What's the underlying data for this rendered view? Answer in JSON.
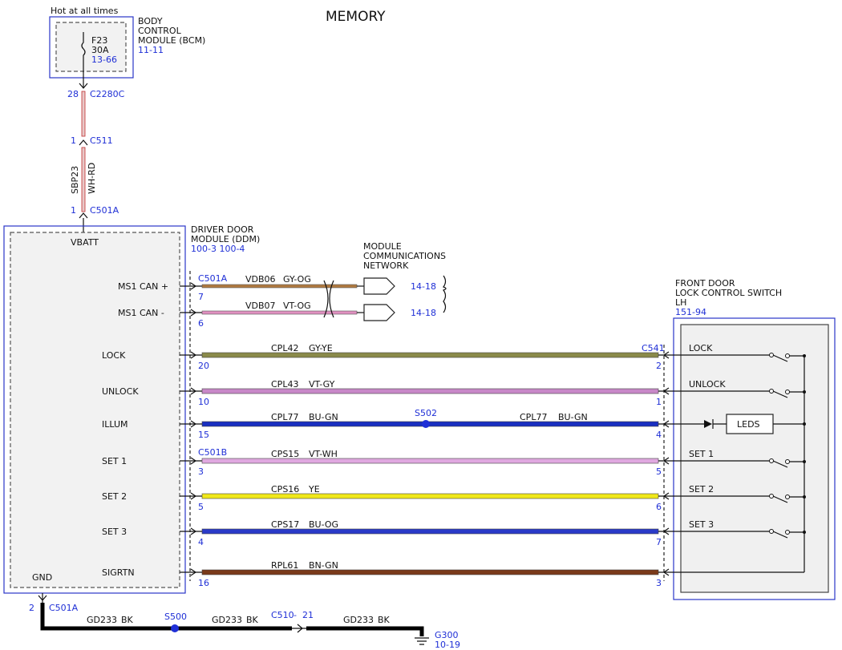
{
  "title": "MEMORY",
  "hot_label": "Hot at all times",
  "bcm": {
    "name_lines": [
      "BODY",
      "CONTROL",
      "MODULE (BCM)"
    ],
    "ref": "11-11",
    "fuse": {
      "id": "F23",
      "rating": "30A",
      "ref": "13-66"
    }
  },
  "feed": {
    "conn_bcm_pin": "28",
    "conn_bcm": "C2280C",
    "conn_mid_pin": "1",
    "conn_mid": "C511",
    "circuit": "SBP23",
    "color": "WH-RD",
    "conn_ddm_pin": "1",
    "conn_ddm": "C501A",
    "vbatt": "VBATT"
  },
  "ddm": {
    "name_lines": [
      "DRIVER DOOR",
      "MODULE (DDM)"
    ],
    "refs": "100-3 100-4",
    "gnd": "GND"
  },
  "network": {
    "name_lines": [
      "MODULE",
      "COMMUNICATIONS",
      "NETWORK"
    ],
    "connector": "C501A",
    "lines": [
      {
        "label": "MS1 CAN +",
        "pin": "7",
        "circuit": "VDB06",
        "color": "GY-OG",
        "ref": "14-18"
      },
      {
        "label": "MS1 CAN -",
        "pin": "6",
        "circuit": "VDB07",
        "color": "VT-OG",
        "ref": "14-18"
      }
    ]
  },
  "switch": {
    "name_lines": [
      "FRONT DOOR",
      "LOCK CONTROL SWITCH",
      "LH"
    ],
    "ref": "151-94",
    "connector": "C541",
    "leds": "LEDS"
  },
  "circuits": [
    {
      "label": "LOCK",
      "ddm_pin": "20",
      "circuit": "CPL42",
      "color": "GY-YE",
      "sw_pin": "2",
      "sw_label": "LOCK",
      "wire_hex": "#8a8a4a"
    },
    {
      "label": "UNLOCK",
      "ddm_pin": "10",
      "circuit": "CPL43",
      "color": "VT-GY",
      "sw_pin": "1",
      "sw_label": "UNLOCK",
      "wire_hex": "#c888c8"
    },
    {
      "label": "ILLUM",
      "ddm_pin": "15",
      "circuit": "CPL77",
      "color": "BU-GN",
      "sw_pin": "4",
      "sw_label": "",
      "splice": "S502",
      "circuit2": "CPL77",
      "color2": "BU-GN",
      "wire_hex": "#1a2fc0"
    },
    {
      "label": "SET 1",
      "ddm_pin": "3",
      "connector": "C501B",
      "circuit": "CPS15",
      "color": "VT-WH",
      "sw_pin": "5",
      "sw_label": "SET 1",
      "wire_hex": "#e0a8e0"
    },
    {
      "label": "SET 2",
      "ddm_pin": "5",
      "circuit": "CPS16",
      "color": "YE",
      "sw_pin": "6",
      "sw_label": "SET 2",
      "wire_hex": "#f0e81a"
    },
    {
      "label": "SET 3",
      "ddm_pin": "4",
      "circuit": "CPS17",
      "color": "BU-OG",
      "sw_pin": "7",
      "sw_label": "SET 3",
      "wire_hex": "#2a3ac8"
    },
    {
      "label": "SIGRTN",
      "ddm_pin": "16",
      "circuit": "RPL61",
      "color": "BN-GN",
      "sw_pin": "3",
      "sw_label": "",
      "wire_hex": "#7a3a1a"
    }
  ],
  "ground": {
    "pin": "2",
    "connector": "C501A",
    "circuit": "GD233",
    "color": "BK",
    "splice": "S500",
    "inline_conn": "C510",
    "inline_pin": "21",
    "gnd_point": "G300",
    "gnd_ref": "10-19"
  }
}
